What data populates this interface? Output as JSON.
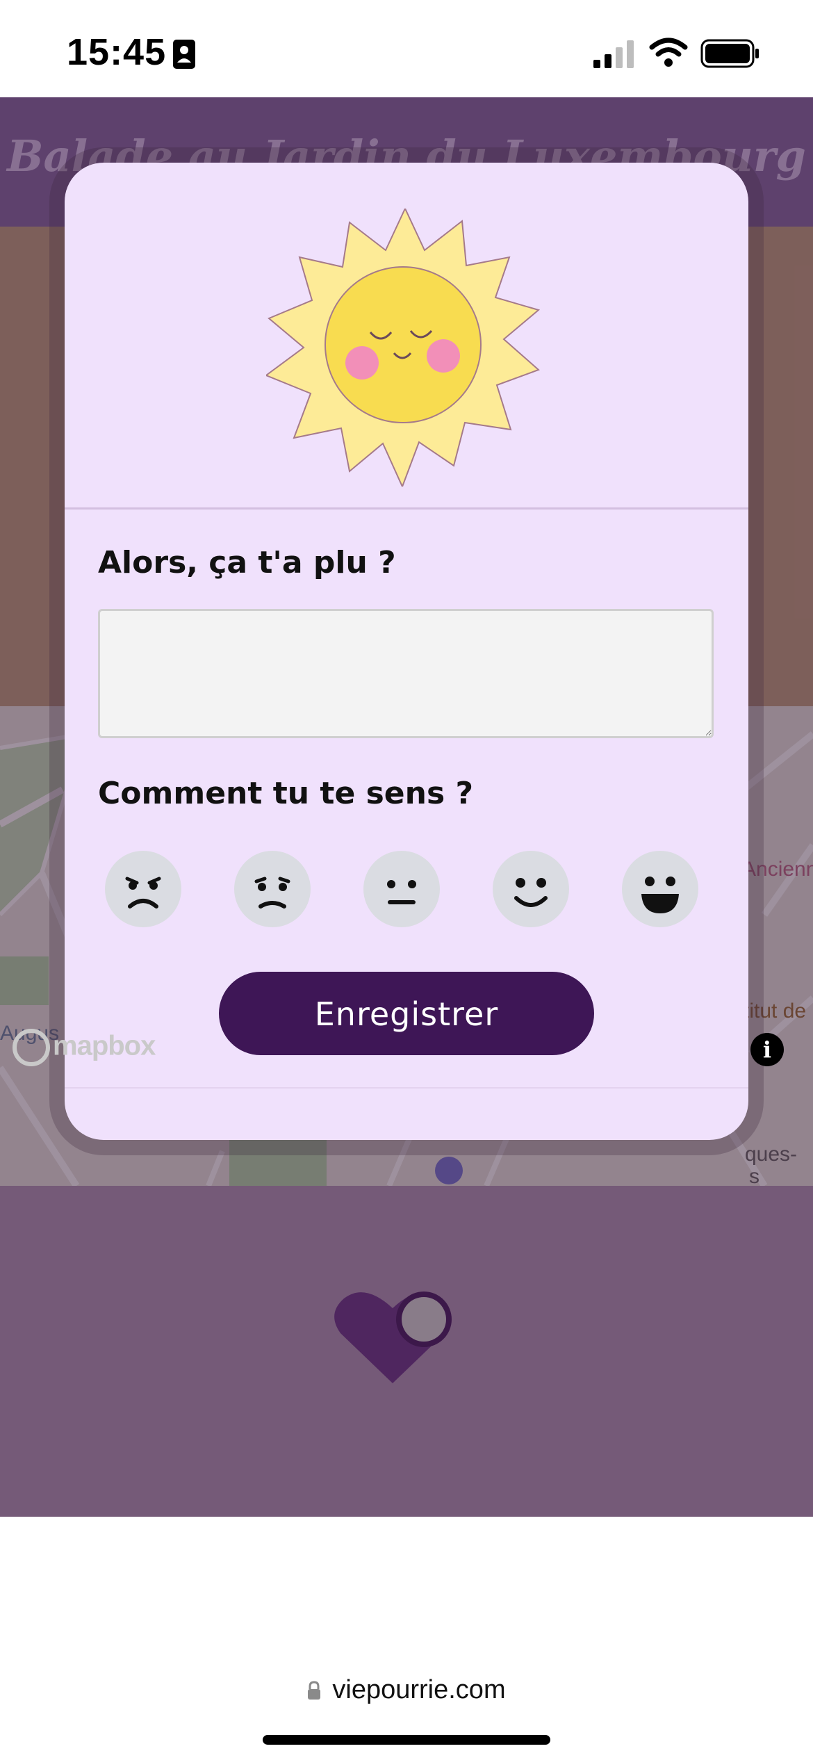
{
  "status_bar": {
    "time": "15:45"
  },
  "app": {
    "title": "Balade au Jardin du Luxembourg",
    "map": {
      "labels": [
        "Ancienn",
        "Augus",
        "titut de",
        "ques-",
        "s"
      ],
      "attribution": "mapbox",
      "info": "i"
    },
    "tabs": [
      {
        "name": "journal",
        "icon": "book-icon"
      },
      {
        "name": "cards",
        "icon": "cards-icon"
      },
      {
        "name": "favorites",
        "icon": "heart-outline-icon"
      }
    ]
  },
  "modal": {
    "illustration": "smiling-sun-illustration",
    "question_1": "Alors, ça t'a plu ?",
    "comment_value": "",
    "comment_placeholder": "",
    "question_2": "Comment tu te sens ?",
    "moods": [
      {
        "name": "very-unhappy",
        "icon": "angry-face-icon"
      },
      {
        "name": "unhappy",
        "icon": "sad-face-icon"
      },
      {
        "name": "neutral",
        "icon": "neutral-face-icon"
      },
      {
        "name": "happy",
        "icon": "smile-face-icon"
      },
      {
        "name": "very-happy",
        "icon": "grin-face-icon"
      }
    ],
    "save_label": "Enregistrer"
  },
  "browser": {
    "url": "viepourrie.com"
  },
  "colors": {
    "modal_bg": "#f0e1fc",
    "button_bg": "#3e1656",
    "tab_bar_bg": "#bea3d3",
    "sun_yellow": "#f8dc50",
    "sun_cheeks": "#f28fb8"
  }
}
